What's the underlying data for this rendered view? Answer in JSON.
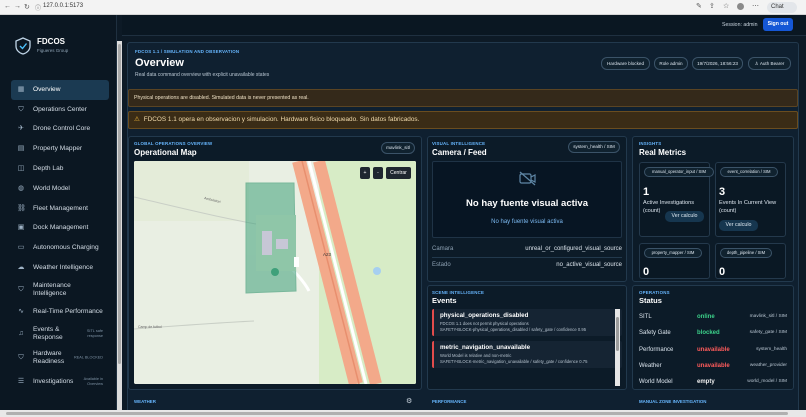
{
  "browser": {
    "url": "127.0.0.1:5173",
    "chat": "Chat"
  },
  "app": {
    "name": "FDCOS",
    "org": "Figueres Group",
    "session": "Session: admin",
    "signout": "Sign out"
  },
  "nav": [
    {
      "label": "Overview",
      "icon": "grid-icon",
      "active": true
    },
    {
      "label": "Operations Center",
      "icon": "shield-icon"
    },
    {
      "label": "Drone Control Core",
      "icon": "plane-icon"
    },
    {
      "label": "Property Mapper",
      "icon": "map-icon"
    },
    {
      "label": "Depth Lab",
      "icon": "layers-icon"
    },
    {
      "label": "World Model",
      "icon": "globe-icon"
    },
    {
      "label": "Fleet Management",
      "icon": "link-icon"
    },
    {
      "label": "Dock Management",
      "icon": "box-icon"
    },
    {
      "label": "Autonomous Charging",
      "icon": "battery-icon"
    },
    {
      "label": "Weather Intelligence",
      "icon": "cloud-icon"
    },
    {
      "label": "Maintenance Intelligence",
      "icon": "shield-icon"
    },
    {
      "label": "Real-Time Performance",
      "icon": "wave-icon"
    },
    {
      "label": "Events & Response",
      "icon": "bell-icon",
      "note": "SITL safe response"
    },
    {
      "label": "Hardware Readiness",
      "icon": "shield-icon",
      "note": "REAL BLOCKED"
    },
    {
      "label": "Investigations",
      "icon": "list-icon",
      "note": "Available in Overview"
    }
  ],
  "header": {
    "eyebrow": "FDCOS 1.1 / SIMULATION AND OBSERVATION",
    "title": "Overview",
    "subtitle": "Real data command overview with explicit unavailable states",
    "chips": [
      "Hardware blocked",
      "Role admin",
      "19/7/2026, 18:56:23",
      "Auth Bearer"
    ]
  },
  "banner1": "Physical operations are disabled. Simulated data is never presented as real.",
  "banner2": "FDCOS 1.1 opera en observacion y simulacion. Hardware fisico bloqueado. Sin datos fabricados.",
  "map": {
    "eyebrow": "GLOBAL OPERATIONS OVERVIEW",
    "title": "Operational Map",
    "chip": "mavlink_sitl",
    "zoom_in": "+",
    "zoom_out": "-",
    "center": "Centrar",
    "road_label": "A23",
    "street": "Carretera de Manresa",
    "tiny": "Camp de futbol"
  },
  "camera": {
    "eyebrow": "VISUAL INTELLIGENCE",
    "title": "Camera / Feed",
    "chip": "system_health / SIM",
    "headline": "No hay fuente visual activa",
    "sub": "No hay fuente visual activa",
    "rows": [
      {
        "k": "Camara",
        "v": "unreal_or_configured_visual_source"
      },
      {
        "k": "Estado",
        "v": "no_active_visual_source"
      }
    ]
  },
  "events": {
    "eyebrow": "SCENE INTELLIGENCE",
    "title": "Events",
    "items": [
      {
        "title": "physical_operations_disabled",
        "d1": "FDCOS 1.1 does not permit physical operations",
        "d2": "SAFETY-BLOCK-physical_operations_disabled / safety_gate / confidence 0.95"
      },
      {
        "title": "metric_navigation_unavailable",
        "d1": "World Model is relative and non-metric",
        "d2": "SAFETY-BLOCK-metric_navigation_unavailable / safety_gate / confidence 0.75"
      }
    ]
  },
  "metrics": {
    "eyebrow": "INSIGHTS",
    "title": "Real Metrics",
    "cards": [
      {
        "chip": "manual_operator_input / SIM",
        "value": "1",
        "label": "Active Investigations (count)",
        "btn": "Ver calculo"
      },
      {
        "chip": "event_correlation / SIM",
        "value": "3",
        "label": "Events In Current View (count)",
        "btn": "Ver calculo"
      },
      {
        "chip": "property_mapper / SIM",
        "value": "0"
      },
      {
        "chip": "depth_pipeline / SIM",
        "value": "0"
      }
    ]
  },
  "status": {
    "eyebrow": "OPERATIONS",
    "title": "Status",
    "rows": [
      {
        "name": "SITL",
        "state": "online",
        "cls": "ok",
        "src": "mavlink_sitl / SIM"
      },
      {
        "name": "Safety Gate",
        "state": "blocked",
        "cls": "ok",
        "src": "safety_gate / SIM"
      },
      {
        "name": "Performance",
        "state": "unavailable",
        "cls": "bad",
        "src": "system_health"
      },
      {
        "name": "Weather",
        "state": "unavailable",
        "cls": "bad",
        "src": "weather_provider"
      },
      {
        "name": "World Model",
        "state": "empty",
        "cls": "mute",
        "src": "world_model / SIM"
      }
    ]
  },
  "bottom": {
    "weather": "WEATHER",
    "performance": "PERFORMANCE",
    "manual": "MANUAL ZONE INVESTIGATION"
  },
  "colors": {
    "accent": "#1557d6",
    "ok": "#3cd18a",
    "bad": "#ff5b5b",
    "eyebrow": "#67b7ff"
  }
}
